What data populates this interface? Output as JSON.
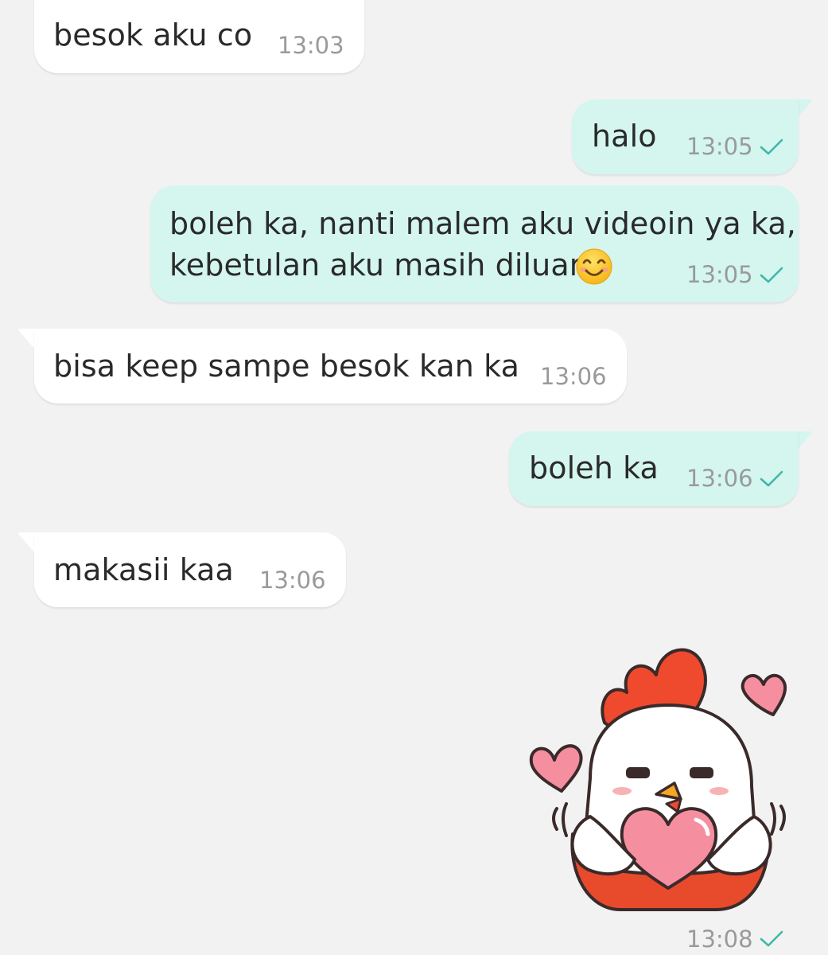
{
  "messages": [
    {
      "direction": "incoming",
      "text": "besok aku co",
      "time": "13:03"
    },
    {
      "direction": "outgoing",
      "text": "halo",
      "time": "13:05",
      "status": "sent-check"
    },
    {
      "direction": "outgoing",
      "text_line1": "boleh ka, nanti malem aku videoin ya ka,",
      "text_line2": "kebetulan aku masih diluar",
      "emoji": "smiling-face-emoji",
      "time": "13:05",
      "status": "sent-check"
    },
    {
      "direction": "incoming",
      "text": "bisa keep sampe besok kan ka",
      "time": "13:06"
    },
    {
      "direction": "outgoing",
      "text": "boleh ka",
      "time": "13:06",
      "status": "sent-check"
    },
    {
      "direction": "incoming",
      "text": "makasii kaa",
      "time": "13:06"
    },
    {
      "direction": "outgoing",
      "type": "sticker",
      "sticker": "chicken-hugging-heart-sticker",
      "time": "13:08",
      "status": "sent-check"
    }
  ],
  "colors": {
    "background": "#f2f2f2",
    "incoming_bubble": "#ffffff",
    "outgoing_bubble": "#d4f6ee",
    "check": "#3fb8a8"
  }
}
